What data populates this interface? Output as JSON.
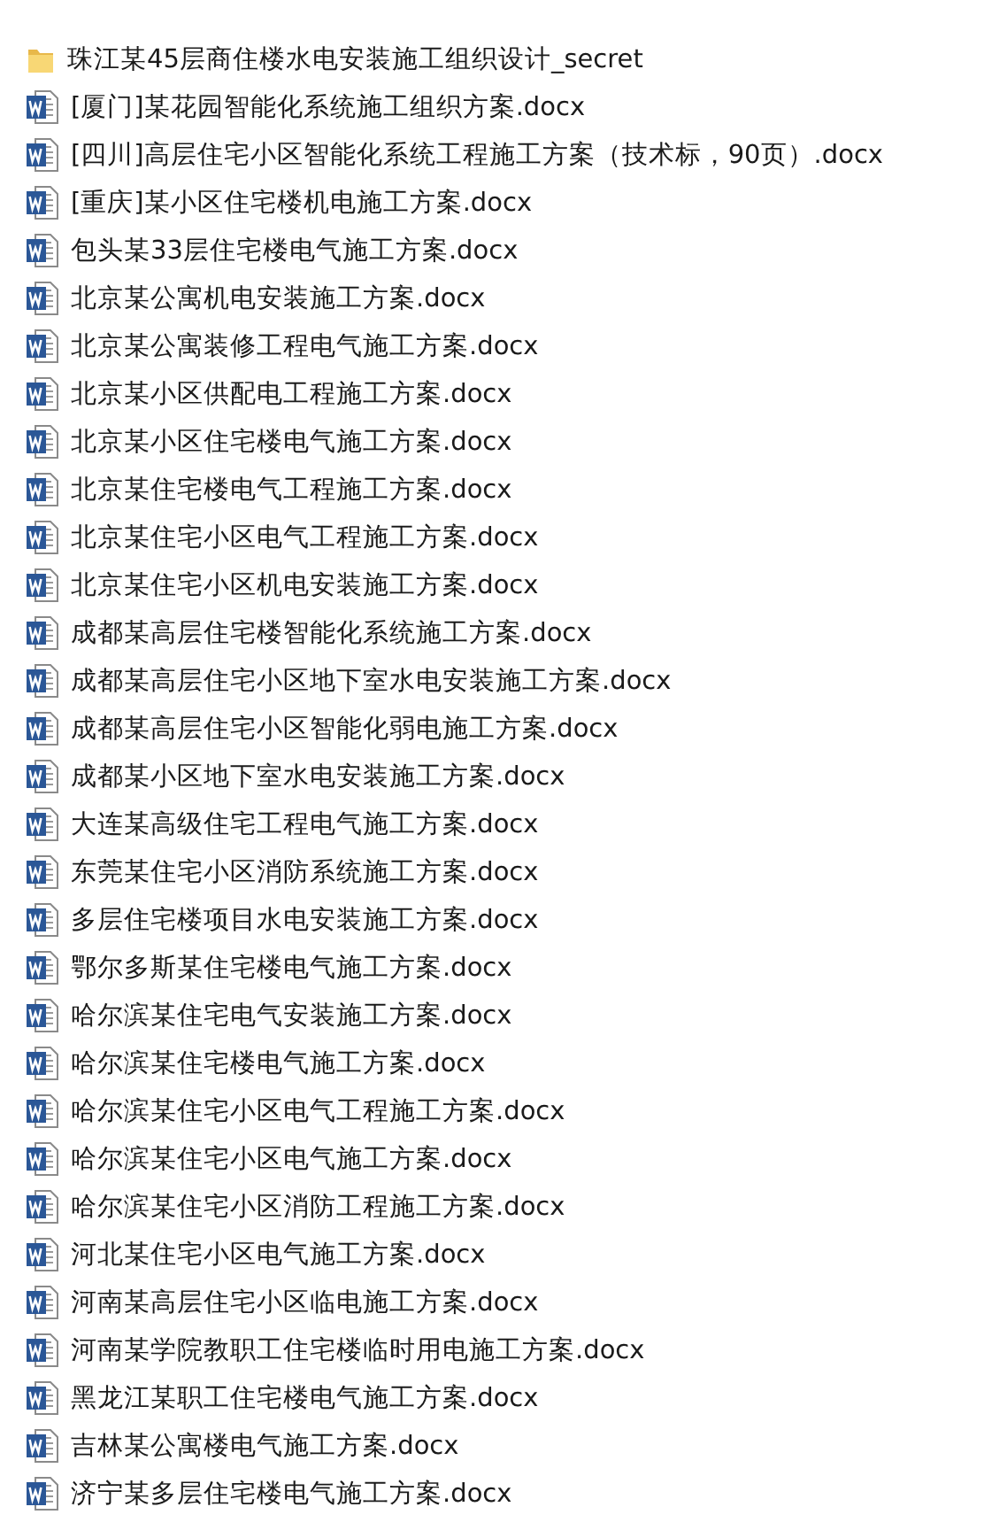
{
  "files": [
    {
      "kind": "folder",
      "name": "珠江某45层商住楼水电安装施工组织设计_secret"
    },
    {
      "kind": "word",
      "name": "[厦门]某花园智能化系统施工组织方案.docx"
    },
    {
      "kind": "word",
      "name": "[四川]高层住宅小区智能化系统工程施工方案（技术标，90页）.docx"
    },
    {
      "kind": "word",
      "name": "[重庆]某小区住宅楼机电施工方案.docx"
    },
    {
      "kind": "word",
      "name": "包头某33层住宅楼电气施工方案.docx"
    },
    {
      "kind": "word",
      "name": "北京某公寓机电安装施工方案.docx"
    },
    {
      "kind": "word",
      "name": "北京某公寓装修工程电气施工方案.docx"
    },
    {
      "kind": "word",
      "name": "北京某小区供配电工程施工方案.docx"
    },
    {
      "kind": "word",
      "name": "北京某小区住宅楼电气施工方案.docx"
    },
    {
      "kind": "word",
      "name": "北京某住宅楼电气工程施工方案.docx"
    },
    {
      "kind": "word",
      "name": "北京某住宅小区电气工程施工方案.docx"
    },
    {
      "kind": "word",
      "name": "北京某住宅小区机电安装施工方案.docx"
    },
    {
      "kind": "word",
      "name": "成都某高层住宅楼智能化系统施工方案.docx"
    },
    {
      "kind": "word",
      "name": "成都某高层住宅小区地下室水电安装施工方案.docx"
    },
    {
      "kind": "word",
      "name": "成都某高层住宅小区智能化弱电施工方案.docx"
    },
    {
      "kind": "word",
      "name": "成都某小区地下室水电安装施工方案.docx"
    },
    {
      "kind": "word",
      "name": "大连某高级住宅工程电气施工方案.docx"
    },
    {
      "kind": "word",
      "name": "东莞某住宅小区消防系统施工方案.docx"
    },
    {
      "kind": "word",
      "name": "多层住宅楼项目水电安装施工方案.docx"
    },
    {
      "kind": "word",
      "name": "鄂尔多斯某住宅楼电气施工方案.docx"
    },
    {
      "kind": "word",
      "name": "哈尔滨某住宅电气安装施工方案.docx"
    },
    {
      "kind": "word",
      "name": "哈尔滨某住宅楼电气施工方案.docx"
    },
    {
      "kind": "word",
      "name": "哈尔滨某住宅小区电气工程施工方案.docx"
    },
    {
      "kind": "word",
      "name": "哈尔滨某住宅小区电气施工方案.docx"
    },
    {
      "kind": "word",
      "name": "哈尔滨某住宅小区消防工程施工方案.docx"
    },
    {
      "kind": "word",
      "name": "河北某住宅小区电气施工方案.docx"
    },
    {
      "kind": "word",
      "name": "河南某高层住宅小区临电施工方案.docx"
    },
    {
      "kind": "word",
      "name": "河南某学院教职工住宅楼临时用电施工方案.docx"
    },
    {
      "kind": "word",
      "name": "黑龙江某职工住宅楼电气施工方案.docx"
    },
    {
      "kind": "word",
      "name": "吉林某公寓楼电气施工方案.docx"
    },
    {
      "kind": "word",
      "name": "济宁某多层住宅楼电气施工方案.docx"
    }
  ]
}
